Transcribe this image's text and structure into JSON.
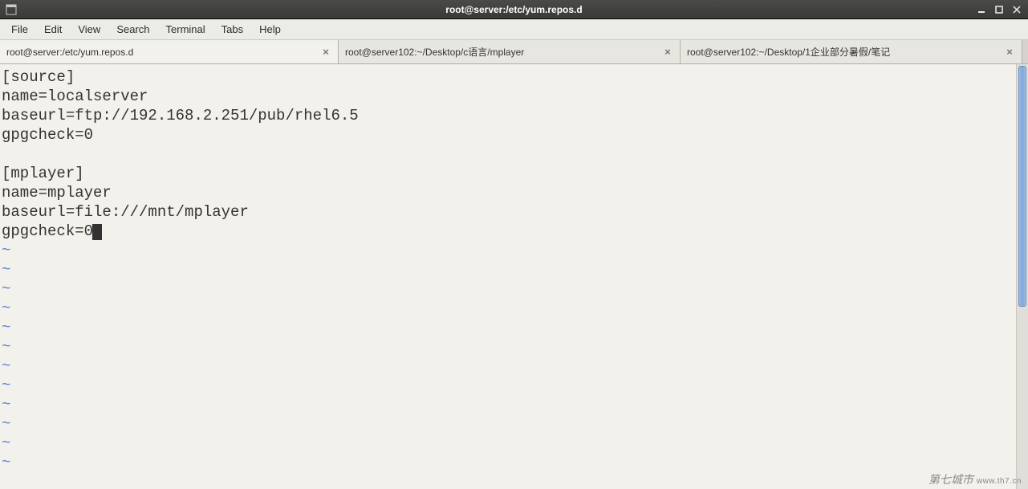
{
  "titlebar": {
    "title": "root@server:/etc/yum.repos.d"
  },
  "menubar": {
    "items": [
      "File",
      "Edit",
      "View",
      "Search",
      "Terminal",
      "Tabs",
      "Help"
    ]
  },
  "tabs": [
    {
      "label": "root@server:/etc/yum.repos.d",
      "active": true
    },
    {
      "label": "root@server102:~/Desktop/c语言/mplayer",
      "active": false
    },
    {
      "label": "root@server102:~/Desktop/1企业部分暑假/笔记",
      "active": false
    }
  ],
  "terminal": {
    "lines": [
      "[source]",
      "name=localserver",
      "baseurl=ftp://192.168.2.251/pub/rhel6.5",
      "gpgcheck=0",
      "",
      "[mplayer]",
      "name=mplayer",
      "baseurl=file:///mnt/mplayer",
      "gpgcheck=0"
    ],
    "tilde_count": 12
  },
  "watermark": {
    "text": "第七城市",
    "url": "www.th7.cn"
  }
}
